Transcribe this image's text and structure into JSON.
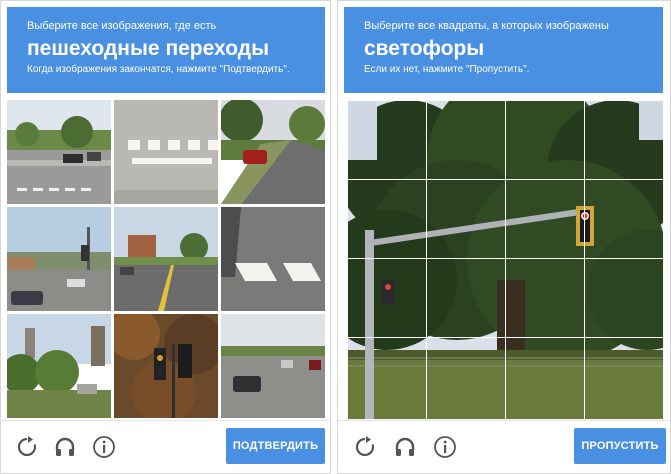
{
  "left": {
    "header": {
      "small": "Выберите все изображения, где есть",
      "big": "пешеходные переходы",
      "note": "Когда изображения закончатся, нажмите \"Подтвердить\"."
    },
    "tiles": [
      {
        "name": "street-corner"
      },
      {
        "name": "crosswalk-topdown"
      },
      {
        "name": "road-red-car"
      },
      {
        "name": "intersection-traffic-lights"
      },
      {
        "name": "road-with-yellow-lines"
      },
      {
        "name": "crosswalk-closeup"
      },
      {
        "name": "buildings-tree"
      },
      {
        "name": "traffic-light-tree"
      },
      {
        "name": "road-cars"
      }
    ],
    "verify_label": "ПОДТВЕРДИТЬ"
  },
  "right": {
    "header": {
      "small": "Выберите все квадраты, в которых изображены",
      "big": "светофоры",
      "note": "Если их нет, нажмите \"Пропустить\"."
    },
    "skip_label": "ПРОПУСТИТЬ"
  },
  "icons": {
    "reload": "reload-icon",
    "audio": "headphones-icon",
    "info": "info-icon"
  },
  "colors": {
    "accent": "#4a90e2"
  }
}
